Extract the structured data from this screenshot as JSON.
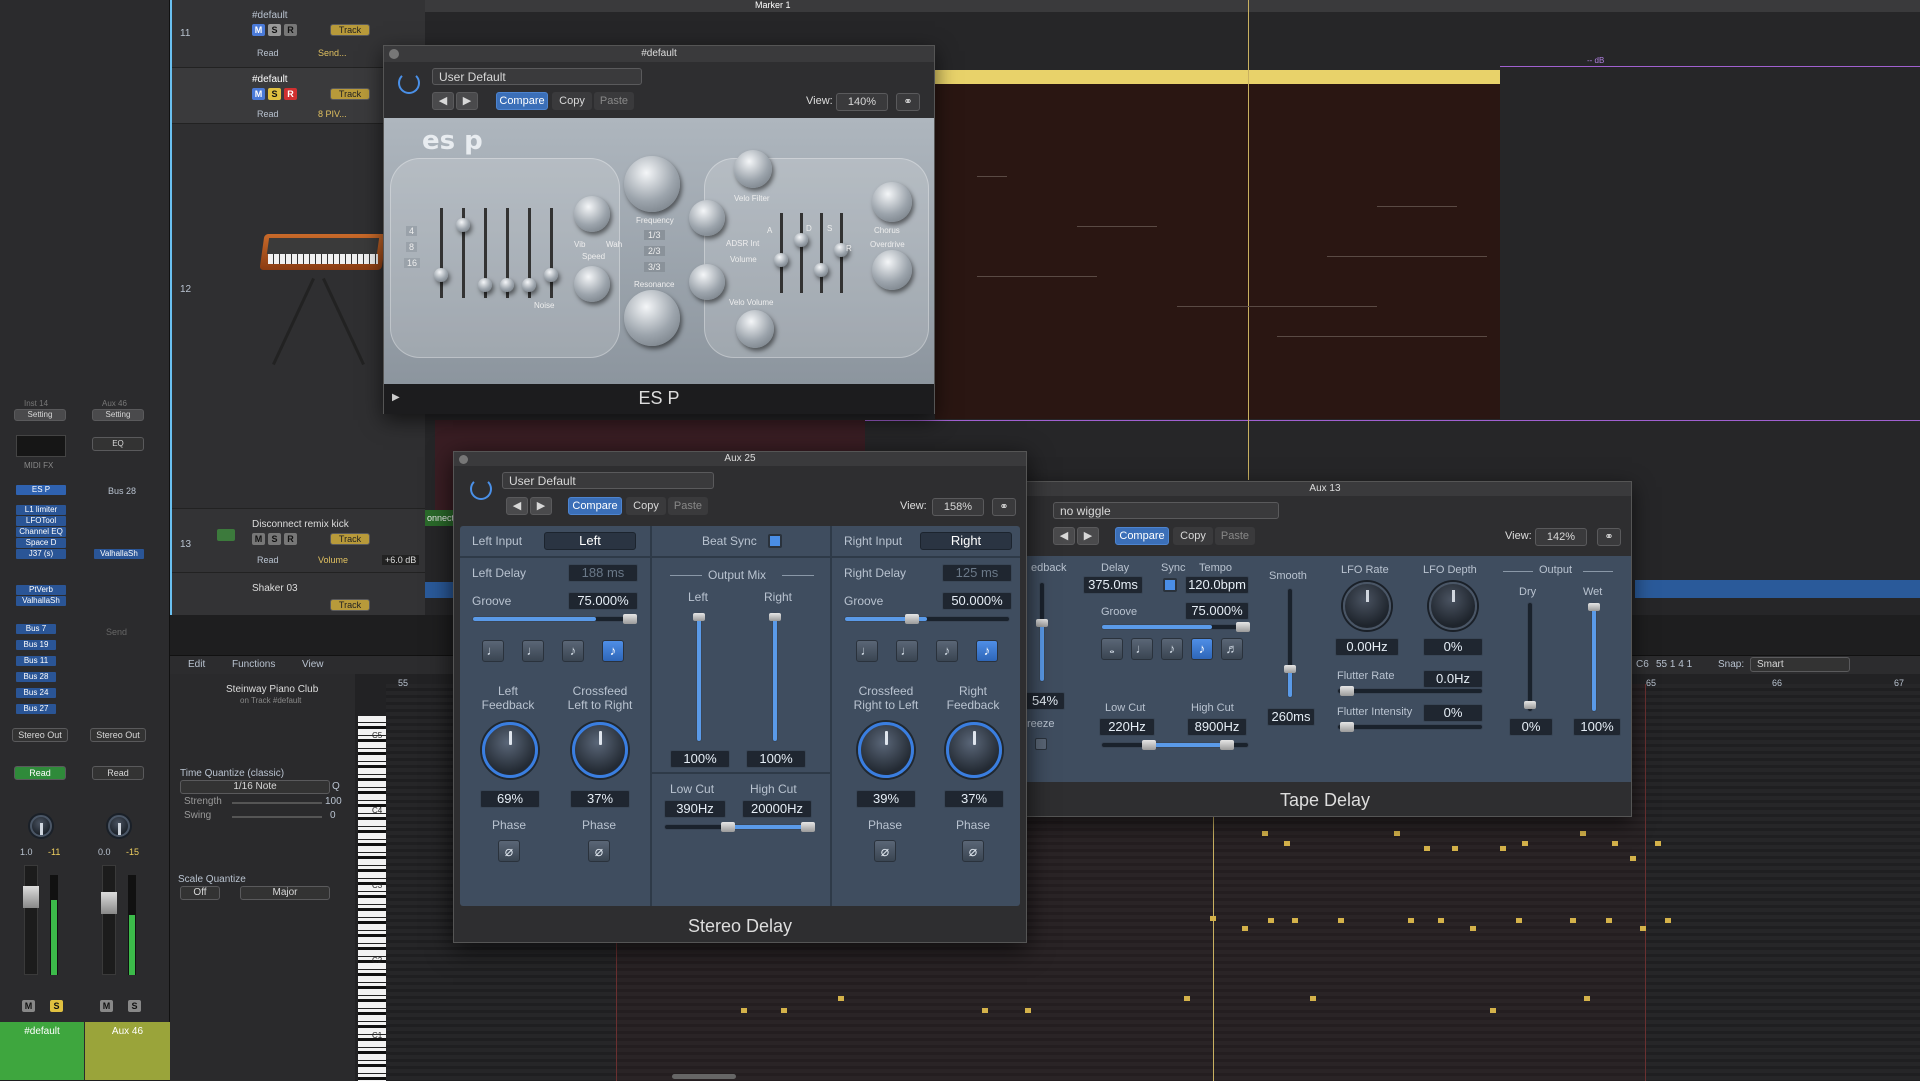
{
  "arrange": {
    "marker": "Marker 1",
    "tracks": [
      {
        "num": "11",
        "name": "#default",
        "read": "Read",
        "extra": "Send..."
      },
      {
        "num": "",
        "name": "#default",
        "read": "Read",
        "extra": "8 PIV..."
      },
      {
        "num": "12",
        "name": "",
        "read": "",
        "extra": ""
      },
      {
        "num": "13",
        "name": "Disconnect remix kick",
        "read": "Read",
        "extra": "Volume",
        "db": "+6.0 dB"
      },
      {
        "num": "",
        "name": "Shaker 03",
        "read": "",
        "extra": ""
      }
    ],
    "track_btn": "Track",
    "ruler_right": [
      "C6",
      "55 1 4 1"
    ],
    "snap_label": "Snap:",
    "snap_value": "Smart",
    "region_label": "onnect",
    "db_label": "-- dB"
  },
  "mixer": {
    "strip1": {
      "plugins": [
        "ES P",
        "L1 limiter",
        "LFOTool",
        "Channel EQ",
        "Space D",
        "J37 (s)"
      ],
      "sends": [
        "PtVerb",
        "ValhallaSh"
      ],
      "buses": [
        "Bus 7",
        "Bus 19",
        "Bus 11",
        "Bus 28",
        "Bus 24",
        "Bus 27"
      ],
      "out": "Stereo Out",
      "auto": "Read",
      "vals": [
        "1.0",
        "-11"
      ],
      "name": "#default",
      "midi_fx": "MIDI FX",
      "setting": "Setting"
    },
    "strip2": {
      "eq": "EQ",
      "bus": "Bus 28",
      "send": "ValhallaSh",
      "send_lbl": "Send",
      "out": "Stereo Out",
      "auto": "Read",
      "vals": [
        "0.0",
        "-15"
      ],
      "name": "Aux 46",
      "setting": "Setting"
    },
    "ms": [
      "M",
      "S"
    ],
    "input_lbls": [
      "Inst 14",
      "Aux 46"
    ]
  },
  "piano": {
    "menus": [
      "Edit",
      "Functions",
      "View"
    ],
    "region": "Steinway Piano Club",
    "region_sub": "on Track #default",
    "tq_label": "Time Quantize (classic)",
    "tq_value": "1/16 Note",
    "q": "Q",
    "strength_lbl": "Strength",
    "strength_val": "100",
    "swing_lbl": "Swing",
    "swing_val": "0",
    "sq_label": "Scale Quantize",
    "sq_off": "Off",
    "sq_scale": "Major",
    "bars": [
      "55",
      "65",
      "66",
      "67"
    ],
    "octaves": [
      "C5",
      "C4",
      "C3",
      "C2",
      "C1"
    ]
  },
  "esp": {
    "window_title": "#default",
    "preset": "User Default",
    "compare": "Compare",
    "copy": "Copy",
    "paste": "Paste",
    "view_lbl": "View:",
    "view_val": "140%",
    "logo": "es p",
    "footer": "ES P",
    "labels": [
      "Frequency",
      "Velo Filter",
      "Wah",
      "Speed",
      "Vib",
      "Resonance",
      "ADSR Int",
      "Volume",
      "Velo Volume",
      "Chorus",
      "Overdrive",
      "Noise"
    ],
    "oct": [
      "4",
      "8",
      "16"
    ],
    "fracs": [
      "1/3",
      "2/3",
      "3/3"
    ],
    "adsr": [
      "A",
      "D",
      "S",
      "R"
    ]
  },
  "stereo": {
    "window_title": "Aux 25",
    "preset": "User Default",
    "compare": "Compare",
    "copy": "Copy",
    "paste": "Paste",
    "view_lbl": "View:",
    "view_val": "158%",
    "left_input_lbl": "Left Input",
    "left_input": "Left",
    "beat_sync": "Beat Sync",
    "right_input_lbl": "Right Input",
    "right_input": "Right",
    "left_delay_lbl": "Left Delay",
    "left_delay": "188 ms",
    "right_delay_lbl": "Right Delay",
    "right_delay": "125 ms",
    "groove_lbl": "Groove",
    "groove_l": "75.000%",
    "groove_r": "50.000%",
    "output_mix": "Output Mix",
    "mix_left": "Left",
    "mix_right": "Right",
    "mix_l_val": "100%",
    "mix_r_val": "100%",
    "lf_lbl": "Left Feedback",
    "xf_lr_lbl": "Crossfeed Left to Right",
    "xf_rl_lbl": "Crossfeed Right to Left",
    "rf_lbl": "Right Feedback",
    "lf_val": "69%",
    "xf_lr_val": "37%",
    "xf_rl_val": "39%",
    "rf_val": "37%",
    "low_cut_lbl": "Low Cut",
    "high_cut_lbl": "High Cut",
    "low_cut": "390Hz",
    "high_cut": "20000Hz",
    "phase": "Phase",
    "footer": "Stereo Delay"
  },
  "tape": {
    "window_title": "Aux 13",
    "preset": "no wiggle",
    "compare": "Compare",
    "copy": "Copy",
    "paste": "Paste",
    "view_lbl": "View:",
    "view_val": "142%",
    "feedback_lbl": "edback",
    "feedback_val": "54%",
    "freeze": "reeze",
    "delay_lbl": "Delay",
    "delay_val": "375.0ms",
    "sync_lbl": "Sync",
    "tempo_lbl": "Tempo",
    "tempo_val": "120.0bpm",
    "groove_lbl": "Groove",
    "groove_val": "75.000%",
    "low_cut_lbl": "Low Cut",
    "low_cut": "220Hz",
    "high_cut_lbl": "High Cut",
    "high_cut": "8900Hz",
    "smooth_lbl": "Smooth",
    "smooth_val": "260ms",
    "lfo_rate_lbl": "LFO Rate",
    "lfo_rate": "0.00Hz",
    "lfo_depth_lbl": "LFO Depth",
    "lfo_depth": "0%",
    "flutter_rate_lbl": "Flutter Rate",
    "flutter_rate": "0.0Hz",
    "flutter_int_lbl": "Flutter Intensity",
    "flutter_int": "0%",
    "output_lbl": "Output",
    "dry_lbl": "Dry",
    "wet_lbl": "Wet",
    "dry": "0%",
    "wet": "100%",
    "footer": "Tape Delay"
  }
}
